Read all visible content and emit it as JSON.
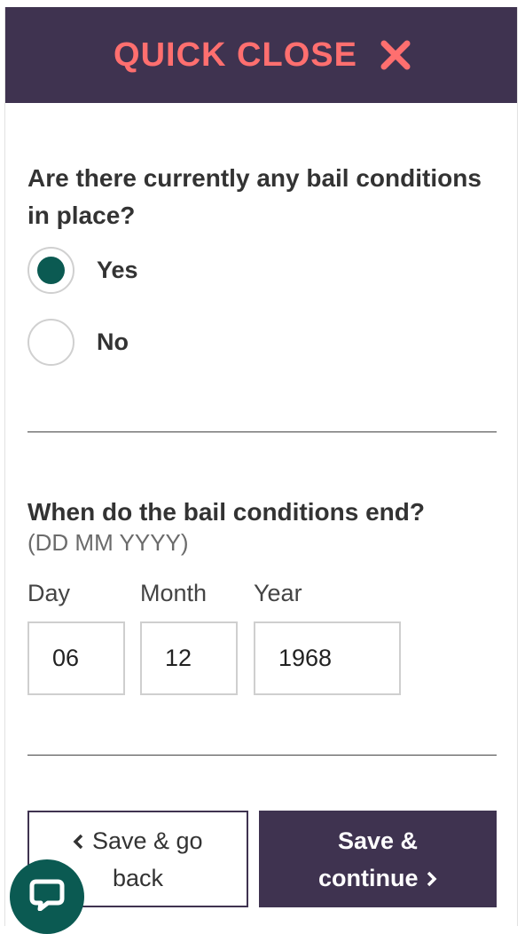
{
  "header": {
    "quick_close_label": "QUICK CLOSE",
    "close_icon": "close-icon"
  },
  "bail_question": {
    "text": "Are there currently any bail conditions in place?",
    "options": [
      {
        "label": "Yes",
        "selected": true
      },
      {
        "label": "No",
        "selected": false
      }
    ]
  },
  "end_date": {
    "question": "When do the bail conditions end?",
    "hint": "(DD MM YYYY)",
    "day": {
      "label": "Day",
      "value": "06"
    },
    "month": {
      "label": "Month",
      "value": "12"
    },
    "year": {
      "label": "Year",
      "value": "1968"
    }
  },
  "actions": {
    "back_label_line1": "Save & go",
    "back_label_line2": "back",
    "continue_label_line1": "Save &",
    "continue_label_line2": "continue"
  },
  "chat": {
    "icon": "chat-icon"
  },
  "colors": {
    "header_bg": "#3f3350",
    "quick_close_text": "#ff6f6f",
    "radio_selected": "#0b5a52",
    "primary_button": "#3f3350",
    "chat_button": "#0b5a52"
  }
}
